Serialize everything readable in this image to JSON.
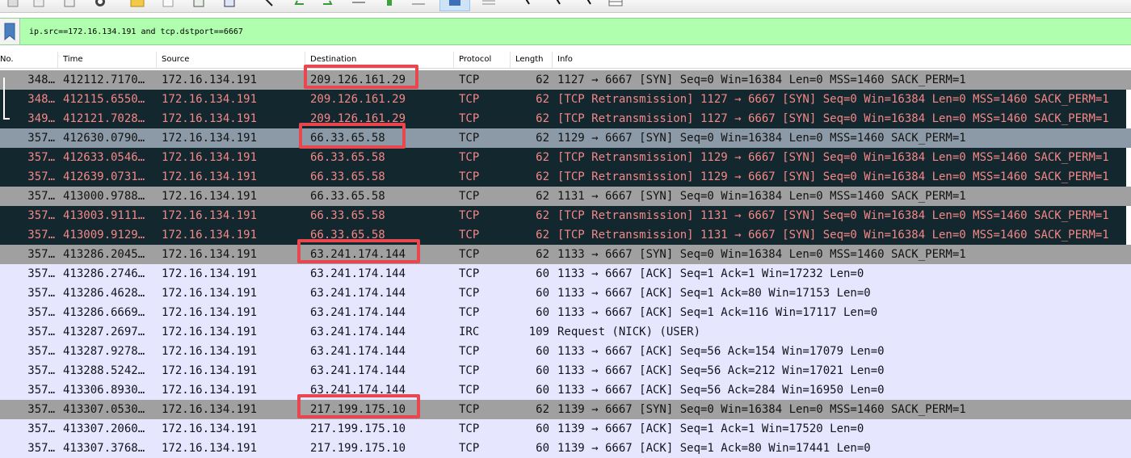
{
  "toolbar": {
    "icons": [
      "open-file-icon",
      "save-icon",
      "close-file-icon",
      "reload-icon",
      "folder-icon",
      "print-icon",
      "find-packet-icon",
      "go-back-icon",
      "go-forward-icon",
      "go-to-packet-icon",
      "first-packet-icon",
      "last-packet-icon",
      "autoscroll-icon",
      "colorize-icon",
      "zoom-in-icon",
      "zoom-out-icon",
      "zoom-normal-icon",
      "resize-columns-icon"
    ]
  },
  "filter": {
    "value": "ip.src==172.16.134.191 and tcp.dstport==6667"
  },
  "columns": {
    "no": "No.",
    "time": "Time",
    "source": "Source",
    "destination": "Destination",
    "protocol": "Protocol",
    "length": "Length",
    "info": "Info"
  },
  "colors": {
    "filter_ok": "#afffaf",
    "row_normal": "#a0a0a0",
    "row_retransmission": "#12272e",
    "retransmission_text": "#f78787",
    "row_light": "#e7e6ff",
    "highlight": "#e8474f"
  },
  "packets": [
    {
      "no": "348…",
      "time": "412112.7170…",
      "src": "172.16.134.191",
      "dst": "209.126.161.29",
      "proto": "TCP",
      "len": "62",
      "info": "1127 → 6667 [SYN] Seq=0 Win=16384 Len=0 MSS=1460 SACK_PERM=1",
      "style": "normal"
    },
    {
      "no": "348…",
      "time": "412115.6550…",
      "src": "172.16.134.191",
      "dst": "209.126.161.29",
      "proto": "TCP",
      "len": "62",
      "info": "[TCP Retransmission] 1127 → 6667 [SYN] Seq=0 Win=16384 Len=0 MSS=1460 SACK_PERM=1",
      "style": "retrans"
    },
    {
      "no": "349…",
      "time": "412121.7028…",
      "src": "172.16.134.191",
      "dst": "209.126.161.29",
      "proto": "TCP",
      "len": "62",
      "info": "[TCP Retransmission] 1127 → 6667 [SYN] Seq=0 Win=16384 Len=0 MSS=1460 SACK_PERM=1",
      "style": "retrans"
    },
    {
      "no": "357…",
      "time": "412630.0790…",
      "src": "172.16.134.191",
      "dst": "66.33.65.58",
      "proto": "TCP",
      "len": "62",
      "info": "1129 → 6667 [SYN] Seq=0 Win=16384 Len=0 MSS=1460 SACK_PERM=1",
      "style": "selected"
    },
    {
      "no": "357…",
      "time": "412633.0546…",
      "src": "172.16.134.191",
      "dst": "66.33.65.58",
      "proto": "TCP",
      "len": "62",
      "info": "[TCP Retransmission] 1129 → 6667 [SYN] Seq=0 Win=16384 Len=0 MSS=1460 SACK_PERM=1",
      "style": "retrans"
    },
    {
      "no": "357…",
      "time": "412639.0731…",
      "src": "172.16.134.191",
      "dst": "66.33.65.58",
      "proto": "TCP",
      "len": "62",
      "info": "[TCP Retransmission] 1129 → 6667 [SYN] Seq=0 Win=16384 Len=0 MSS=1460 SACK_PERM=1",
      "style": "retrans"
    },
    {
      "no": "357…",
      "time": "413000.9788…",
      "src": "172.16.134.191",
      "dst": "66.33.65.58",
      "proto": "TCP",
      "len": "62",
      "info": "1131 → 6667 [SYN] Seq=0 Win=16384 Len=0 MSS=1460 SACK_PERM=1",
      "style": "normal"
    },
    {
      "no": "357…",
      "time": "413003.9111…",
      "src": "172.16.134.191",
      "dst": "66.33.65.58",
      "proto": "TCP",
      "len": "62",
      "info": "[TCP Retransmission] 1131 → 6667 [SYN] Seq=0 Win=16384 Len=0 MSS=1460 SACK_PERM=1",
      "style": "retrans"
    },
    {
      "no": "357…",
      "time": "413009.9129…",
      "src": "172.16.134.191",
      "dst": "66.33.65.58",
      "proto": "TCP",
      "len": "62",
      "info": "[TCP Retransmission] 1131 → 6667 [SYN] Seq=0 Win=16384 Len=0 MSS=1460 SACK_PERM=1",
      "style": "retrans"
    },
    {
      "no": "357…",
      "time": "413286.2045…",
      "src": "172.16.134.191",
      "dst": "63.241.174.144",
      "proto": "TCP",
      "len": "62",
      "info": "1133 → 6667 [SYN] Seq=0 Win=16384 Len=0 MSS=1460 SACK_PERM=1",
      "style": "normal"
    },
    {
      "no": "357…",
      "time": "413286.2746…",
      "src": "172.16.134.191",
      "dst": "63.241.174.144",
      "proto": "TCP",
      "len": "60",
      "info": "1133 → 6667 [ACK] Seq=1 Ack=1 Win=17232 Len=0",
      "style": "light"
    },
    {
      "no": "357…",
      "time": "413286.4628…",
      "src": "172.16.134.191",
      "dst": "63.241.174.144",
      "proto": "TCP",
      "len": "60",
      "info": "1133 → 6667 [ACK] Seq=1 Ack=80 Win=17153 Len=0",
      "style": "light"
    },
    {
      "no": "357…",
      "time": "413286.6669…",
      "src": "172.16.134.191",
      "dst": "63.241.174.144",
      "proto": "TCP",
      "len": "60",
      "info": "1133 → 6667 [ACK] Seq=1 Ack=116 Win=17117 Len=0",
      "style": "light"
    },
    {
      "no": "357…",
      "time": "413287.2697…",
      "src": "172.16.134.191",
      "dst": "63.241.174.144",
      "proto": "IRC",
      "len": "109",
      "info": "Request (NICK) (USER)",
      "style": "light"
    },
    {
      "no": "357…",
      "time": "413287.9278…",
      "src": "172.16.134.191",
      "dst": "63.241.174.144",
      "proto": "TCP",
      "len": "60",
      "info": "1133 → 6667 [ACK] Seq=56 Ack=154 Win=17079 Len=0",
      "style": "light"
    },
    {
      "no": "357…",
      "time": "413288.5242…",
      "src": "172.16.134.191",
      "dst": "63.241.174.144",
      "proto": "TCP",
      "len": "60",
      "info": "1133 → 6667 [ACK] Seq=56 Ack=212 Win=17021 Len=0",
      "style": "light"
    },
    {
      "no": "357…",
      "time": "413306.8930…",
      "src": "172.16.134.191",
      "dst": "63.241.174.144",
      "proto": "TCP",
      "len": "60",
      "info": "1133 → 6667 [ACK] Seq=56 Ack=284 Win=16950 Len=0",
      "style": "light"
    },
    {
      "no": "357…",
      "time": "413307.0530…",
      "src": "172.16.134.191",
      "dst": "217.199.175.10",
      "proto": "TCP",
      "len": "62",
      "info": "1139 → 6667 [SYN] Seq=0 Win=16384 Len=0 MSS=1460 SACK_PERM=1",
      "style": "normal"
    },
    {
      "no": "357…",
      "time": "413307.2060…",
      "src": "172.16.134.191",
      "dst": "217.199.175.10",
      "proto": "TCP",
      "len": "60",
      "info": "1139 → 6667 [ACK] Seq=1 Ack=1 Win=17520 Len=0",
      "style": "light"
    },
    {
      "no": "357…",
      "time": "413307.3768…",
      "src": "172.16.134.191",
      "dst": "217.199.175.10",
      "proto": "TCP",
      "len": "60",
      "info": "1139 → 6667 [ACK] Seq=1 Ack=80 Win=17441 Len=0",
      "style": "light"
    }
  ]
}
